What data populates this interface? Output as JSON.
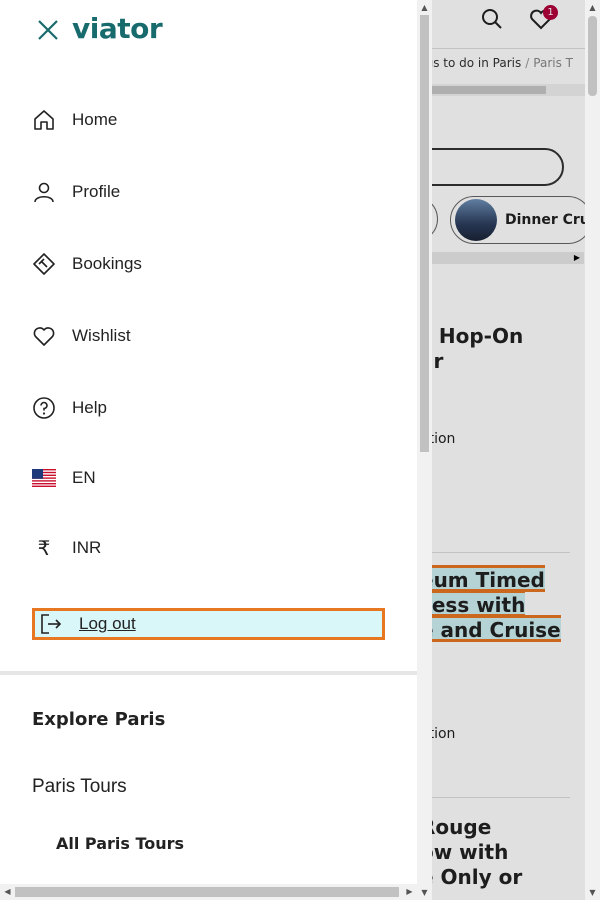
{
  "drawer": {
    "logo": "viator",
    "menu": [
      {
        "label": "Home",
        "icon": "home-icon"
      },
      {
        "label": "Profile",
        "icon": "profile-icon"
      },
      {
        "label": "Bookings",
        "icon": "bookings-icon"
      },
      {
        "label": "Wishlist",
        "icon": "heart-icon"
      },
      {
        "label": "Help",
        "icon": "help-icon"
      },
      {
        "label": "EN",
        "icon": "us-flag-icon"
      },
      {
        "label": "INR",
        "icon": "rupee-icon"
      }
    ],
    "logout_label": "Log out",
    "explore_heading": "Explore Paris",
    "tours_link": "Paris Tours",
    "all_tours": "All Paris Tours"
  },
  "background": {
    "wishlist_count": "1",
    "breadcrumb_current": "ngs to do in Paris",
    "breadcrumb_next": "Paris T",
    "chip_label": "Dinner Cru",
    "card1_title_l1": "s Hop-On",
    "card1_title_l2": "ar",
    "card1_duration": "ation",
    "card2_title_l1": "eum Timed",
    "card2_title_l2": "cess with",
    "card2_title_l3": "e and Cruise",
    "card2_duration": "ation",
    "card3_title_l1": "Rouge",
    "card3_title_l2": "ow with",
    "card3_title_l3": "e Only or"
  },
  "colors": {
    "brand": "#186b6d",
    "focus_outline": "#e87722",
    "focus_fill": "#d9f6f9",
    "badge": "#b3003b"
  }
}
